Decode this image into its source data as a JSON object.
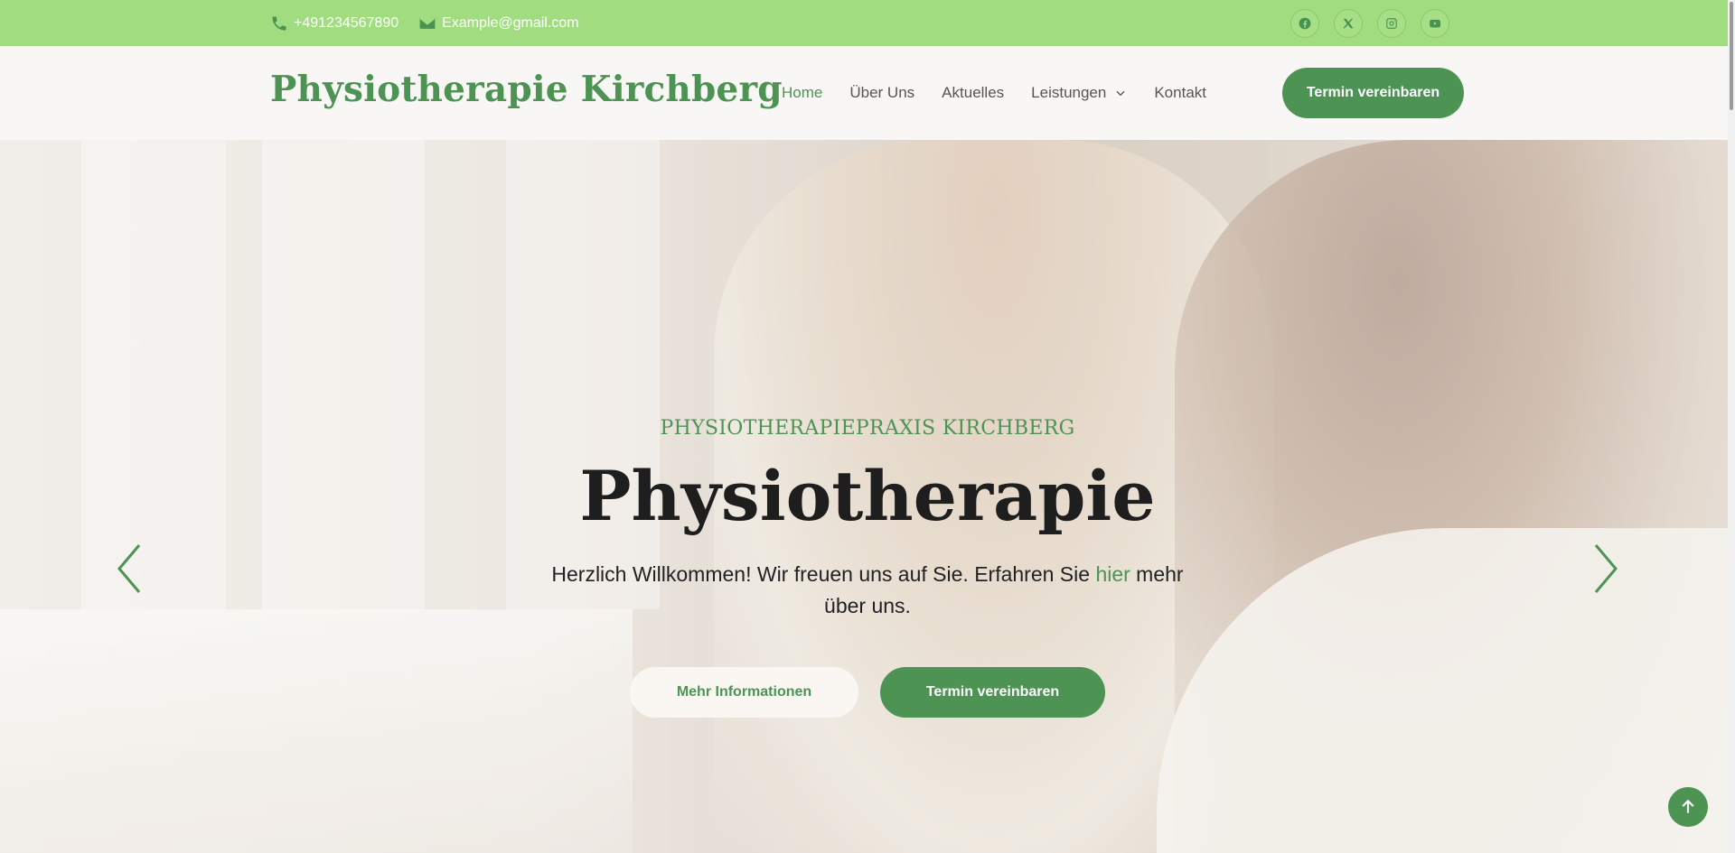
{
  "topbar": {
    "phone": "+491234567890",
    "email": "Example@gmail.com",
    "socials": [
      "facebook-icon",
      "x-icon",
      "instagram-icon",
      "youtube-icon"
    ]
  },
  "header": {
    "logo": "Physiotherapie Kirchberg",
    "nav": [
      "Home",
      "Über Uns",
      "Aktuelles",
      "Leistungen",
      "Kontakt"
    ],
    "active_nav": "Home",
    "cta": "Termin vereinbaren"
  },
  "hero": {
    "eyebrow": "PHYSIOTHERAPIEPRAXIS KIRCHBERG",
    "title": "Physiotherapie",
    "sub_before": "Herzlich Willkommen! Wir freuen uns auf Sie. Erfahren Sie ",
    "sub_link": "hier",
    "sub_after": " mehr über uns.",
    "btn_more": "Mehr Informationen",
    "btn_book": "Termin vereinbaren"
  },
  "colors": {
    "accent": "#4c9354",
    "topbar": "#a1dd80",
    "header_bg": "#f9f7f5"
  }
}
